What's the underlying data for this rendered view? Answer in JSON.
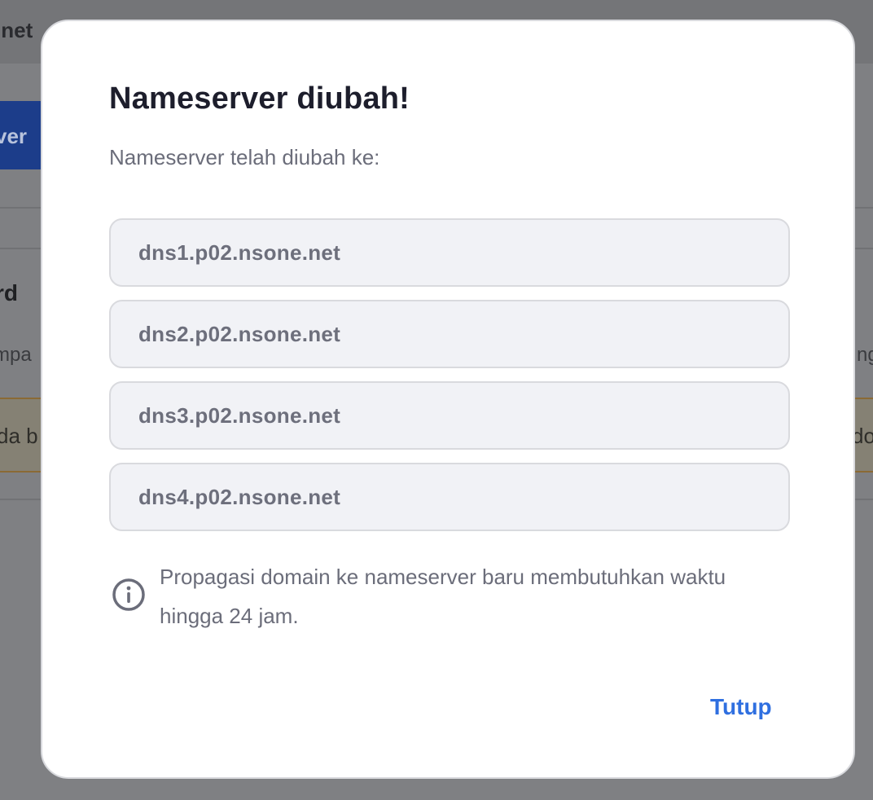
{
  "background": {
    "domain_fragment": ".net",
    "button_fragment": "ver",
    "heading_fragment": "rd",
    "text_left_fragment": "mpa",
    "text_right_fragment": "ng",
    "alert_left_fragment": "da b",
    "alert_right_fragment": "do"
  },
  "modal": {
    "title": "Nameserver diubah!",
    "subtitle": "Nameserver telah diubah ke:",
    "nameservers": [
      "dns1.p02.nsone.net",
      "dns2.p02.nsone.net",
      "dns3.p02.nsone.net",
      "dns4.p02.nsone.net"
    ],
    "info_icon": "info-circle-icon",
    "info_text": "Propagasi domain ke nameserver baru membutuhkan waktu hingga 24 jam.",
    "close_label": "Tutup"
  },
  "colors": {
    "accent": "#2f6fe0",
    "overlay": "#7f8083",
    "field_bg": "#f1f2f6",
    "title": "#1d1e2c",
    "muted_text": "#6b6d7a"
  }
}
